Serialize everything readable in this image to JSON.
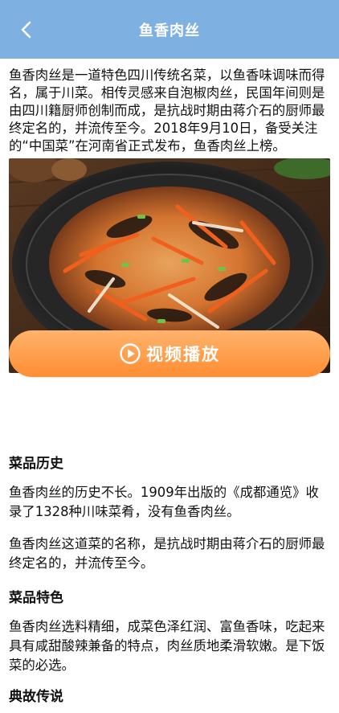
{
  "header": {
    "title": "鱼香肉丝",
    "back_icon": "chevron-left-icon"
  },
  "intro": "鱼香肉丝是一道特色四川传统名菜，以鱼香味调味而得名，属于川菜。相传灵感来自泡椒肉丝，民国年间则是由四川籍厨师创制而成，是抗战时期由蒋介石的厨师最终定名的，并流传至今。2018年9月10日，备受关注的“中国菜”在河南省正式发布，鱼香肉丝上榜。",
  "video_button": {
    "label": "视频播放",
    "icon": "play-circle-icon",
    "color": "#ff9a45"
  },
  "sections": [
    {
      "heading": "菜品历史",
      "paragraphs": [
        "鱼香肉丝的历史不长。1909年出版的《成都通览》收录了1328种川味菜肴，没有鱼香肉丝。",
        "鱼香肉丝这道菜的名称，是抗战时期由蒋介石的厨师最终定名的，并流传至今。"
      ]
    },
    {
      "heading": "菜品特色",
      "paragraphs": [
        "鱼香肉丝选料精细，成菜色泽红润、富鱼香味，吃起来具有咸甜酸辣兼备的特点，肉丝质地柔滑软嫩。是下饭菜的必选。"
      ]
    },
    {
      "heading": "典故传说",
      "paragraphs": []
    }
  ],
  "colors": {
    "header_bg": "#7fb0e2",
    "button_gradient_top": "#ffb36d",
    "button_gradient_bottom": "#ff8d33"
  }
}
